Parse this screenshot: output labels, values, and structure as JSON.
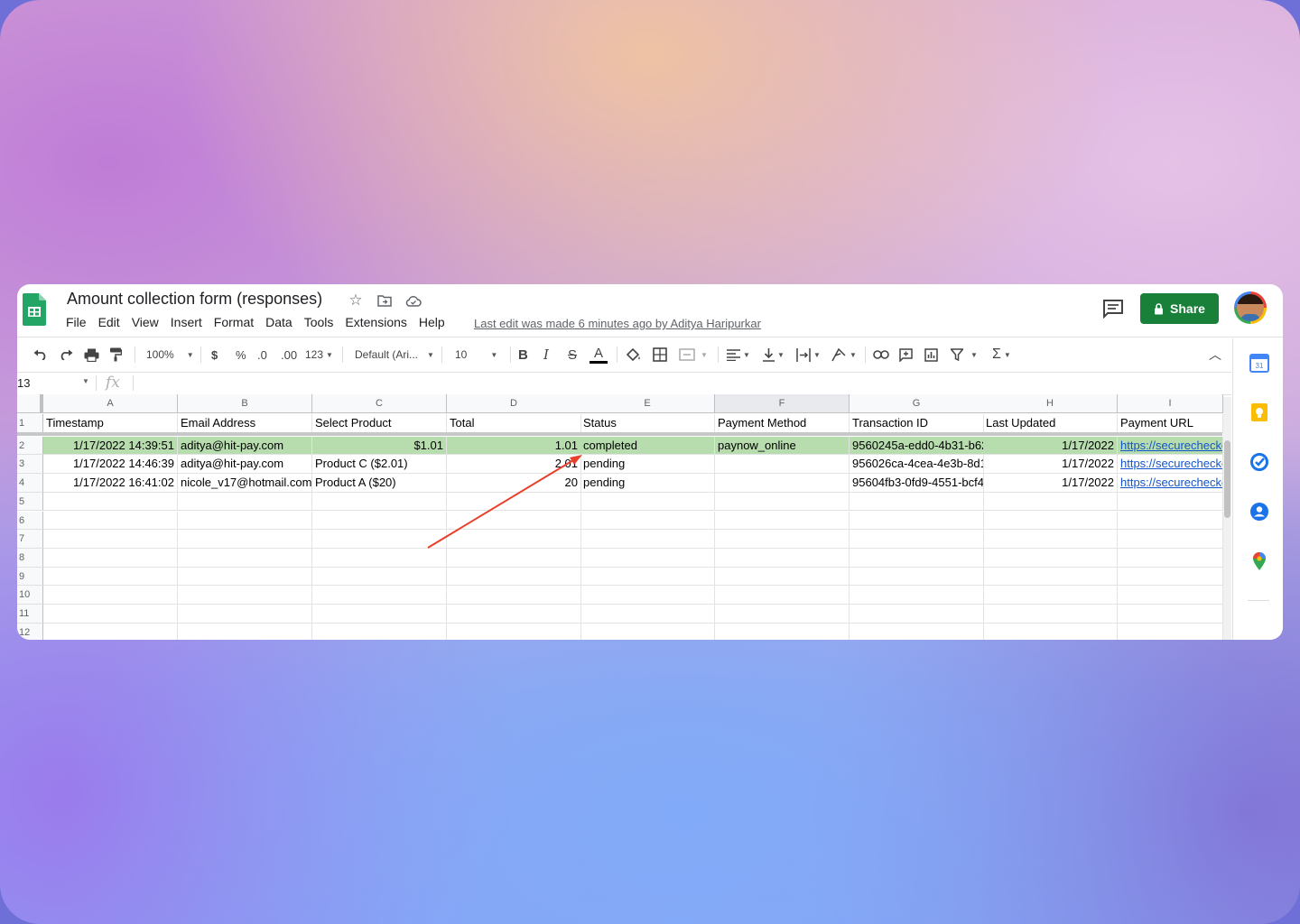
{
  "header": {
    "title": "Amount collection form (responses)",
    "menu": [
      "File",
      "Edit",
      "View",
      "Insert",
      "Format",
      "Data",
      "Tools",
      "Extensions",
      "Help"
    ],
    "last_edit": "Last edit was made 6 minutes ago by Aditya Haripurkar",
    "share_label": "Share"
  },
  "toolbar": {
    "zoom": "100%",
    "currency": "$",
    "percent": "%",
    "dec_decrease": ".0",
    "dec_increase": ".00",
    "more_formats": "123",
    "font": "Default (Ari...",
    "font_size": "10",
    "bold": "B",
    "italic": "I",
    "strike": "S",
    "text_color": "A"
  },
  "formula_bar": {
    "name_box": "13",
    "fx": "fx"
  },
  "grid": {
    "columns": [
      "A",
      "B",
      "C",
      "D",
      "E",
      "F",
      "G",
      "H",
      "I"
    ],
    "row_numbers": [
      "1",
      "2",
      "3",
      "4",
      "5",
      "6",
      "7",
      "8",
      "9",
      "10",
      "11",
      "12"
    ],
    "rows": [
      [
        "Timestamp",
        "Email Address",
        "Select Product",
        "Total",
        "Status",
        "Payment Method",
        "Transaction ID",
        "Last Updated",
        "Payment URL"
      ],
      [
        "1/17/2022 14:39:51",
        "aditya@hit-pay.com",
        "$1.01",
        "1.01",
        "completed",
        "paynow_online",
        "9560245a-edd0-4b31-b62",
        "1/17/2022",
        "https://securecheckout"
      ],
      [
        "1/17/2022 14:46:39",
        "aditya@hit-pay.com",
        "Product C ($2.01)",
        "2.01",
        "pending",
        "",
        "956026ca-4cea-4e3b-8d1",
        "1/17/2022",
        "https://securecheckout"
      ],
      [
        "1/17/2022 16:41:02",
        "nicole_v17@hotmail.com",
        "Product A ($20)",
        "20",
        "pending",
        "",
        "95604fb3-0fd9-4551-bcf4",
        "1/17/2022",
        "https://securecheckout"
      ]
    ],
    "highlight_color": "#b7dcae",
    "link_color": "#1155cc"
  },
  "colors": {
    "share": "#188038",
    "annotation_arrow": "#e8402a"
  },
  "icons": [
    "undo-icon",
    "redo-icon",
    "print-icon",
    "paint-format-icon",
    "star-icon",
    "move-folder-icon",
    "cloud-status-icon",
    "comment-icon",
    "lock-icon",
    "calendar-icon",
    "keep-icon",
    "tasks-icon",
    "contacts-icon",
    "maps-icon"
  ]
}
